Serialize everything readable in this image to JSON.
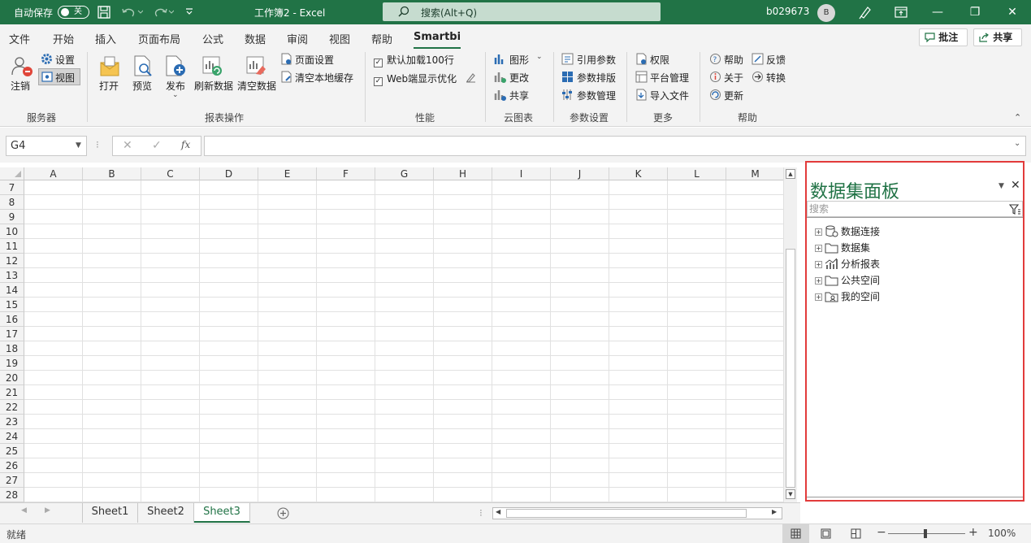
{
  "titlebar": {
    "autosave_label": "自动保存",
    "autosave_state": "关",
    "doc_title": "工作簿2  -  Excel",
    "search_placeholder": "搜索(Alt+Q)",
    "user_name": "b029673",
    "avatar_initial": "B",
    "accent_color": "#217346"
  },
  "menu": {
    "tabs": [
      "文件",
      "开始",
      "插入",
      "页面布局",
      "公式",
      "数据",
      "审阅",
      "视图",
      "帮助",
      "Smartbi"
    ],
    "active_tab": "Smartbi",
    "comment_button": "批注",
    "share_button": "共享"
  },
  "ribbon": {
    "server": {
      "logout": "注销",
      "settings": "设置",
      "view": "视图",
      "label": "服务器"
    },
    "report": {
      "open": "打开",
      "preview": "预览",
      "publish": "发布",
      "refresh": "刷新数据",
      "clear": "清空数据",
      "page_setup": "页面设置",
      "clear_cache": "清空本地缓存",
      "label": "报表操作"
    },
    "performance": {
      "default_load": "默认加载100行",
      "web_opt": "Web端显示优化",
      "label": "性能"
    },
    "cloud_chart": {
      "chart": "图形",
      "change": "更改",
      "share": "共享",
      "label": "云图表"
    },
    "params": {
      "ref": "引用参数",
      "layout": "参数排版",
      "manage": "参数管理",
      "label": "参数设置"
    },
    "more": {
      "perm": "权限",
      "platform": "平台管理",
      "import": "导入文件",
      "label": "更多"
    },
    "help": {
      "help": "帮助",
      "feedback": "反馈",
      "about": "关于",
      "convert": "转换",
      "update": "更新",
      "label": "帮助"
    }
  },
  "formula_bar": {
    "name_box": "G4",
    "fx_label": "fx",
    "formula": ""
  },
  "grid": {
    "columns": [
      "A",
      "B",
      "C",
      "D",
      "E",
      "F",
      "G",
      "H",
      "I",
      "J",
      "K",
      "L",
      "M"
    ],
    "rows": [
      "7",
      "8",
      "9",
      "10",
      "11",
      "12",
      "13",
      "14",
      "15",
      "16",
      "17",
      "18",
      "19",
      "20",
      "21",
      "22",
      "23",
      "24",
      "25",
      "26",
      "27",
      "28"
    ]
  },
  "sheets": {
    "tabs": [
      "Sheet1",
      "Sheet2",
      "Sheet3"
    ],
    "active": "Sheet3"
  },
  "status": {
    "ready": "就绪",
    "zoom": "100%"
  },
  "panel": {
    "title": "数据集面板",
    "search_placeholder": "搜索",
    "items": [
      "数据连接",
      "数据集",
      "分析报表",
      "公共空间",
      "我的空间"
    ]
  }
}
